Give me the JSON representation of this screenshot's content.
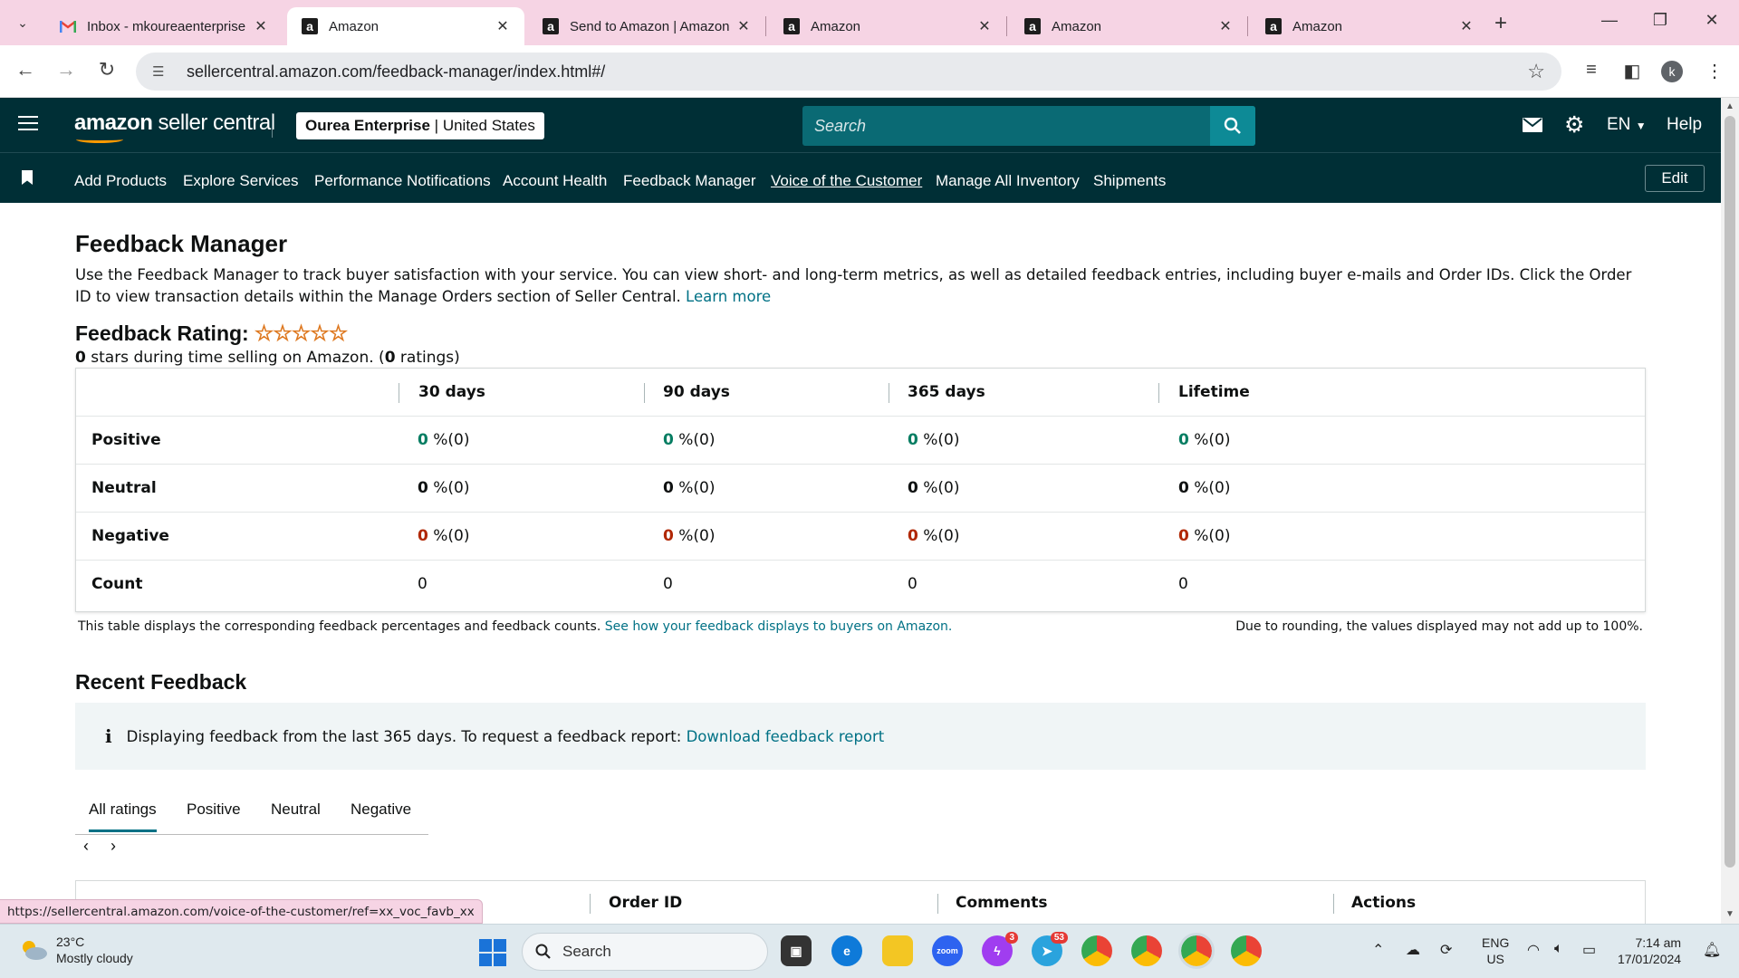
{
  "browser": {
    "tabs": [
      {
        "title": "Inbox - mkoureaenterprise",
        "icon": "gmail-icon"
      },
      {
        "title": "Amazon",
        "icon": "amazon-icon"
      },
      {
        "title": "Send to Amazon | Amazon",
        "icon": "amazon-icon"
      },
      {
        "title": "Amazon",
        "icon": "amazon-icon"
      },
      {
        "title": "Amazon",
        "icon": "amazon-icon"
      },
      {
        "title": "Amazon",
        "icon": "amazon-icon"
      }
    ],
    "active_tab": 1,
    "url": "sellercentral.amazon.com/feedback-manager/index.html#/",
    "profile_initial": "k",
    "status_url": "https://sellercentral.amazon.com/voice-of-the-customer/ref=xx_voc_favb_xx"
  },
  "header": {
    "logo_bold": "amazon",
    "logo_rest": " seller central",
    "store_name": "Ourea Enterprise",
    "store_region": "United States",
    "search_placeholder": "Search",
    "language": "EN",
    "help": "Help",
    "edit": "Edit",
    "nav": [
      "Add Products",
      "Explore Services",
      "Performance Notifications",
      "Account Health",
      "Feedback Manager",
      "Voice of the Customer",
      "Manage All Inventory",
      "Shipments"
    ]
  },
  "page": {
    "title": "Feedback Manager",
    "intro": "Use the Feedback Manager to track buyer satisfaction with your service. You can view short- and long-term metrics, as well as detailed feedback entries, including buyer e-mails and Order IDs. Click the Order ID to view transaction details within the Manage Orders section of Seller Central.",
    "learn_more": "Learn more",
    "rating_label": "Feedback Rating:",
    "rating_stars": 0,
    "rating_value": "0",
    "rating_text_mid": " stars during time selling on Amazon. (",
    "rating_count": "0",
    "rating_text_end": " ratings)",
    "table": {
      "columns": [
        "30 days",
        "90 days",
        "365 days",
        "Lifetime"
      ],
      "rows": [
        {
          "label": "Positive",
          "cells": [
            {
              "n": "0",
              "t": " %(0)"
            },
            {
              "n": "0",
              "t": " %(0)"
            },
            {
              "n": "0",
              "t": " %(0)"
            },
            {
              "n": "0",
              "t": " %(0)"
            }
          ]
        },
        {
          "label": "Neutral",
          "cells": [
            {
              "n": "0",
              "t": " %(0)"
            },
            {
              "n": "0",
              "t": " %(0)"
            },
            {
              "n": "0",
              "t": " %(0)"
            },
            {
              "n": "0",
              "t": " %(0)"
            }
          ]
        },
        {
          "label": "Negative",
          "cells": [
            {
              "n": "0",
              "t": " %(0)"
            },
            {
              "n": "0",
              "t": " %(0)"
            },
            {
              "n": "0",
              "t": " %(0)"
            },
            {
              "n": "0",
              "t": " %(0)"
            }
          ]
        },
        {
          "label": "Count",
          "cells": [
            {
              "n": "",
              "t": "0"
            },
            {
              "n": "",
              "t": "0"
            },
            {
              "n": "",
              "t": "0"
            },
            {
              "n": "",
              "t": "0"
            }
          ]
        }
      ]
    },
    "table_note": "This table displays the corresponding feedback percentages and feedback counts.",
    "table_note_link": "See how your feedback displays to buyers on Amazon.",
    "rounding_note": "Due to rounding, the values displayed may not add up to 100%.",
    "recent_title": "Recent Feedback",
    "info_text": "Displaying feedback from the last 365 days. To request a feedback report:",
    "info_link": "Download feedback report",
    "rating_tabs": [
      "All ratings",
      "Positive",
      "Neutral",
      "Negative"
    ],
    "bottom_columns": [
      "Order ID",
      "Comments",
      "Actions"
    ]
  },
  "taskbar": {
    "temperature": "23°C",
    "weather": "Mostly cloudy",
    "search": "Search",
    "lang_top": "ENG",
    "lang_bottom": "US",
    "time": "7:14 am",
    "date": "17/01/2024",
    "messenger_badge": "3",
    "telegram_badge": "53"
  }
}
